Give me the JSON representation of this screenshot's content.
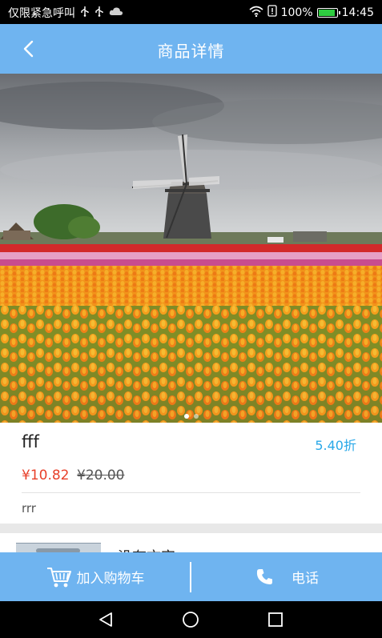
{
  "status_bar": {
    "carrier_text": "仅限紧急呼叫",
    "left_icons": [
      "usb-icon",
      "usb-icon",
      "cloud-icon"
    ],
    "right_icons": [
      "wifi-icon",
      "sim-alert-icon"
    ],
    "battery_percent": "100%",
    "time": "14:45"
  },
  "header": {
    "title": "商品详情",
    "back_icon": "chevron-left-icon"
  },
  "carousel": {
    "image": "windmill-tulip-field",
    "slide_count": 2,
    "active_index": 0
  },
  "product": {
    "name": "fff",
    "discount": "5.40折",
    "price": "¥10.82",
    "original_price": "¥20.00",
    "description": "rrr"
  },
  "next_section": {
    "partial_text": "没有文字"
  },
  "action_bar": {
    "cart_label": "加入购物车",
    "cart_icon": "shopping-cart-icon",
    "phone_label": "电话",
    "phone_icon": "phone-icon"
  },
  "nav_bar": {
    "icons": [
      "back-triangle-icon",
      "home-circle-icon",
      "recents-square-icon"
    ]
  },
  "colors": {
    "accent": "#6fb4f0",
    "price": "#e8402a",
    "discount": "#29a8e8"
  }
}
